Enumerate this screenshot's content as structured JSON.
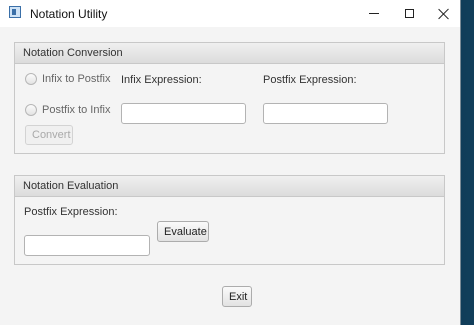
{
  "window": {
    "title": "Notation Utility",
    "controls": {
      "minimize_icon": "minimize-icon",
      "maximize_icon": "maximize-icon",
      "close_icon": "close-icon"
    }
  },
  "conversion": {
    "header": "Notation Conversion",
    "radio_infix_to_postfix": "Infix to Postfix",
    "radio_postfix_to_infix": "Postfix to Infix",
    "infix_label": "Infix Expression:",
    "postfix_label": "Postfix Expression:",
    "infix_value": "",
    "postfix_value": "",
    "convert_label": "Convert",
    "convert_enabled": false
  },
  "evaluation": {
    "header": "Notation Evaluation",
    "postfix_label": "Postfix Expression:",
    "postfix_value": "",
    "evaluate_label": "Evaluate"
  },
  "footer": {
    "exit_label": "Exit"
  },
  "colors": {
    "window_bg": "#f4f4f4",
    "panel_border": "#c8c8c8",
    "disabled_text": "#a9a9a9"
  }
}
